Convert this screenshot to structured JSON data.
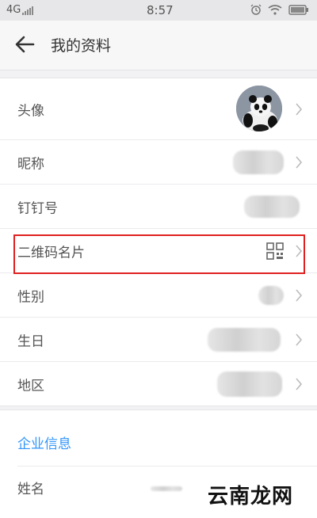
{
  "status_bar": {
    "network": "4G",
    "time": "8:57"
  },
  "header": {
    "title": "我的资料"
  },
  "profile_rows": [
    {
      "label": "头像"
    },
    {
      "label": "昵称"
    },
    {
      "label": "钉钉号"
    },
    {
      "label": "二维码名片"
    },
    {
      "label": "性别"
    },
    {
      "label": "生日"
    },
    {
      "label": "地区"
    }
  ],
  "enterprise": {
    "section_title": "企业信息",
    "name_label": "姓名"
  },
  "watermark": "云南龙网",
  "colors": {
    "accent": "#3296fa",
    "highlight": "#e02020"
  }
}
